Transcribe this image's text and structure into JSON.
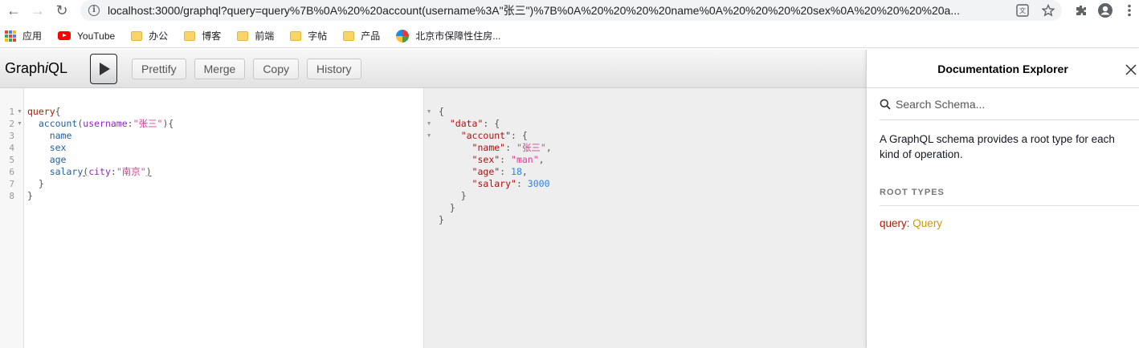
{
  "browser": {
    "url": "localhost:3000/graphql?query=query%7B%0A%20%20account(username%3A\"张三\")%7B%0A%20%20%20%20name%0A%20%20%20%20sex%0A%20%20%20%20a...",
    "nav": {
      "back": "←",
      "forward": "→",
      "reload": "↻"
    },
    "bookmarks": [
      {
        "label": "应用",
        "icon": "apps-grid-icon"
      },
      {
        "label": "YouTube",
        "icon": "youtube-icon"
      },
      {
        "label": "办公",
        "icon": "folder-icon"
      },
      {
        "label": "博客",
        "icon": "folder-icon"
      },
      {
        "label": "前端",
        "icon": "folder-icon"
      },
      {
        "label": "字帖",
        "icon": "folder-icon"
      },
      {
        "label": "产品",
        "icon": "folder-icon"
      },
      {
        "label": "北京市保障性住房...",
        "icon": "site-favicon"
      }
    ]
  },
  "graphiql": {
    "logo_pre": "Graph",
    "logo_i": "i",
    "logo_post": "QL",
    "toolbar": {
      "prettify": "Prettify",
      "merge": "Merge",
      "copy": "Copy",
      "history": "History"
    },
    "editor": {
      "line_numbers": [
        "1",
        "2",
        "3",
        "4",
        "5",
        "6",
        "7",
        "8"
      ],
      "query_kw": "query",
      "account": "account",
      "username_arg": "username",
      "username_val": "\"张三\"",
      "fields": [
        "name",
        "sex",
        "age"
      ],
      "salary": "salary",
      "city_arg": "city",
      "city_val": "\"南京\""
    },
    "result": {
      "data_key": "\"data\"",
      "account_key": "\"account\"",
      "name_key": "\"name\"",
      "name_val": "\"张三\"",
      "sex_key": "\"sex\"",
      "sex_val": "\"man\"",
      "age_key": "\"age\"",
      "age_val": "18",
      "salary_key": "\"salary\"",
      "salary_val": "3000"
    },
    "docs": {
      "title": "Documentation Explorer",
      "search_placeholder": "Search Schema...",
      "description": "A GraphQL schema provides a root type for each kind of operation.",
      "root_types_title": "ROOT TYPES",
      "root_kw": "query",
      "root_type": "Query"
    }
  }
}
